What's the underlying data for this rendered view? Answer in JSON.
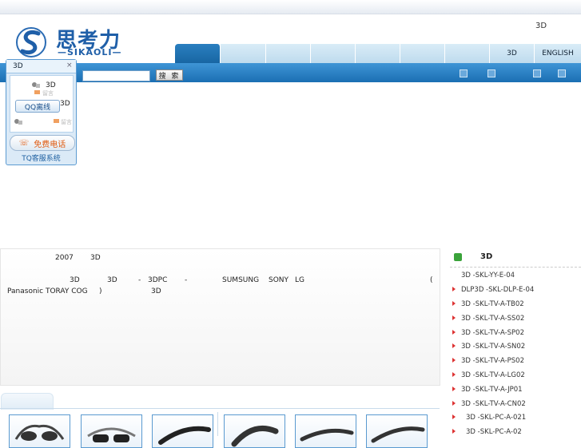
{
  "header": {
    "logo_cn": "思考力",
    "logo_en": "—SIKAOLI—",
    "top_link": "3D"
  },
  "nav": {
    "tabs": [
      "",
      "",
      "",
      "",
      "",
      "",
      "",
      "3D",
      "ENGLISH"
    ]
  },
  "search": {
    "button_label": "搜 索",
    "placeholder": ""
  },
  "widget": {
    "title": "3D",
    "close": "×",
    "line1": "3D",
    "leave_msg": "留言",
    "qq_label": "QQ离线",
    "line2": "3D",
    "call_label": "免费电话",
    "footer": "TQ客服系统"
  },
  "intro": {
    "line1_year": "2007",
    "line1_3d": "3D",
    "line2_parts": [
      "3D",
      "3D",
      "-",
      "3DPC",
      "-",
      "SUMSUNG",
      "SONY",
      "LG",
      "("
    ],
    "line3_a": "Panasonic TORAY COG",
    "line3_b": ")",
    "line3_c": "3D"
  },
  "product_list": {
    "title": "3D",
    "items": [
      "3D -SKL-YY-E-04",
      "DLP3D -SKL-DLP-E-04",
      "3D    -SKL-TV-A-TB02",
      "3D    -SKL-TV-A-SS02",
      "3D    -SKL-TV-A-SP02",
      "3D    -SKL-TV-A-SN02",
      "3D    -SKL-TV-A-PS02",
      "3D    -SKL-TV-A-LG02",
      "3D    -SKL-TV-A-JP01",
      "3D    -SKL-TV-A-CN02",
      "3D -SKL-PC-A-021",
      "3D -SKL-PC-A-02"
    ]
  },
  "colors": {
    "brand_blue": "#1b6fb3",
    "tab_light": "#cfe4f4",
    "arrow_red": "#dd3333"
  }
}
